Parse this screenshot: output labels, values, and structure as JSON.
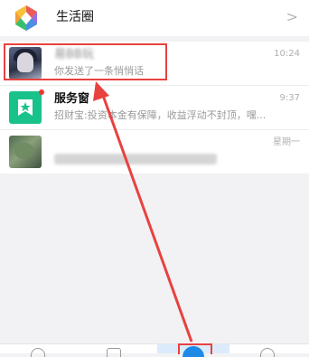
{
  "life_circle": {
    "label": "生活圈",
    "chevron": ">"
  },
  "chats": [
    {
      "name": "易BB玩",
      "preview": "你发送了一条悄悄话",
      "time": "10:24",
      "avatar": "anime-avatar",
      "name_blurred": true
    },
    {
      "name": "服务窗",
      "preview": "招财宝:投资本金有保障，收益浮动不封顶，嘿...",
      "time": "9:37",
      "avatar": "service-window-icon",
      "unread_dot": true
    },
    {
      "name": "",
      "preview": "",
      "time": "星期一",
      "avatar": "photo-avatar",
      "name_blurred": true
    }
  ],
  "colors": {
    "highlight_red": "#e8423f",
    "service_green": "#19c28a",
    "active_tab_blue": "#1e8ae8",
    "unread_red": "#f43530"
  },
  "tabs": [
    "home-tab",
    "koubei-tab",
    "friends-tab",
    "me-tab"
  ],
  "active_tab": "friends-tab"
}
